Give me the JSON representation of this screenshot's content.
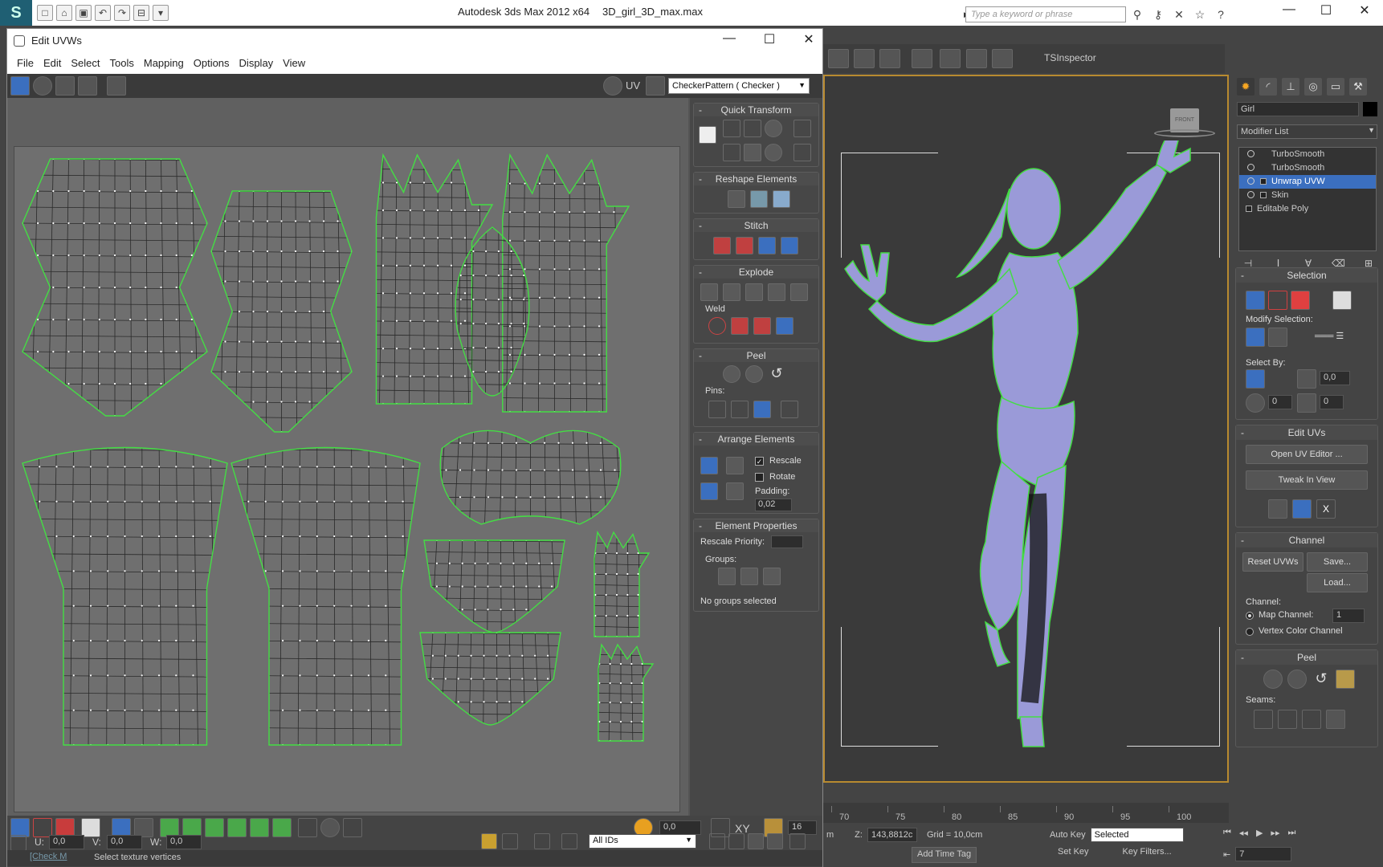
{
  "app": {
    "title": "Autodesk 3ds Max  2012 x64",
    "file": "3D_girl_3D_max.max",
    "search_placeholder": "Type a keyword or phrase",
    "logo": "S"
  },
  "uvw_window": {
    "title": "Edit UVWs",
    "menus": [
      "File",
      "Edit",
      "Select",
      "Tools",
      "Mapping",
      "Options",
      "Display",
      "View"
    ],
    "uv_label": "UV",
    "texture_dropdown": "CheckerPattern  ( Checker )"
  },
  "uvw_side": {
    "quick_transform": "Quick Transform",
    "reshape_elements": "Reshape Elements",
    "stitch": "Stitch",
    "explode": "Explode",
    "weld": "Weld",
    "peel": "Peel",
    "pins": "Pins:",
    "arrange_elements": "Arrange Elements",
    "rescale": "Rescale",
    "rotate": "Rotate",
    "padding_label": "Padding:",
    "padding_value": "0,02",
    "element_properties": "Element Properties",
    "rescale_priority": "Rescale Priority:",
    "groups": "Groups:",
    "no_groups": "No groups selected"
  },
  "uvw_bottom": {
    "spinner_value": "0,0",
    "xy_label": "XY",
    "grid_value": "16",
    "u_label": "U:",
    "u_value": "0,0",
    "v_label": "V:",
    "v_value": "0,0",
    "w_label": "W:",
    "w_value": "0,0",
    "ids_dropdown": "All IDs",
    "status_link": "[Check M",
    "status_prompt": "Select texture vertices"
  },
  "viewport": {
    "tsinspector": "TSInspector",
    "viewcube_label": "FRONT",
    "model_color": "#9a9ad8",
    "seam_color": "#44dd44"
  },
  "timeline": {
    "ticks": [
      "70",
      "75",
      "80",
      "85",
      "90",
      "95",
      "100"
    ]
  },
  "status_right": {
    "z_label": "Z:",
    "z_value": "143,8812c",
    "m_prefix": "m",
    "grid": "Grid = 10,0cm",
    "add_time_tag": "Add Time Tag",
    "auto_key": "Auto Key",
    "set_key": "Set Key",
    "selected": "Selected",
    "key_filters": "Key Filters...",
    "frame": "7"
  },
  "command_panel": {
    "object_name": "Girl",
    "modifier_list": "Modifier List",
    "stack": [
      {
        "label": "TurboSmooth",
        "selected": false,
        "has_plus": false
      },
      {
        "label": "TurboSmooth",
        "selected": false,
        "has_plus": false
      },
      {
        "label": "Unwrap UVW",
        "selected": true,
        "has_plus": true
      },
      {
        "label": "Skin",
        "selected": false,
        "has_plus": true
      },
      {
        "label": "Editable Poly",
        "selected": false,
        "has_plus": true,
        "plain": true
      }
    ],
    "selection": "Selection",
    "modify_selection": "Modify Selection:",
    "select_by": "Select By:",
    "select_by_value": "0,0",
    "select_by_v1": "0",
    "select_by_v2": "0",
    "edit_uvs": "Edit UVs",
    "open_uv_editor": "Open UV Editor ...",
    "tweak_in_view": "Tweak In View",
    "channel": "Channel",
    "reset_uvws": "Reset UVWs",
    "save": "Save...",
    "load": "Load...",
    "channel_label": "Channel:",
    "map_channel": "Map Channel:",
    "map_channel_value": "1",
    "vertex_color_channel": "Vertex Color Channel",
    "peel": "Peel",
    "seams": "Seams:"
  }
}
